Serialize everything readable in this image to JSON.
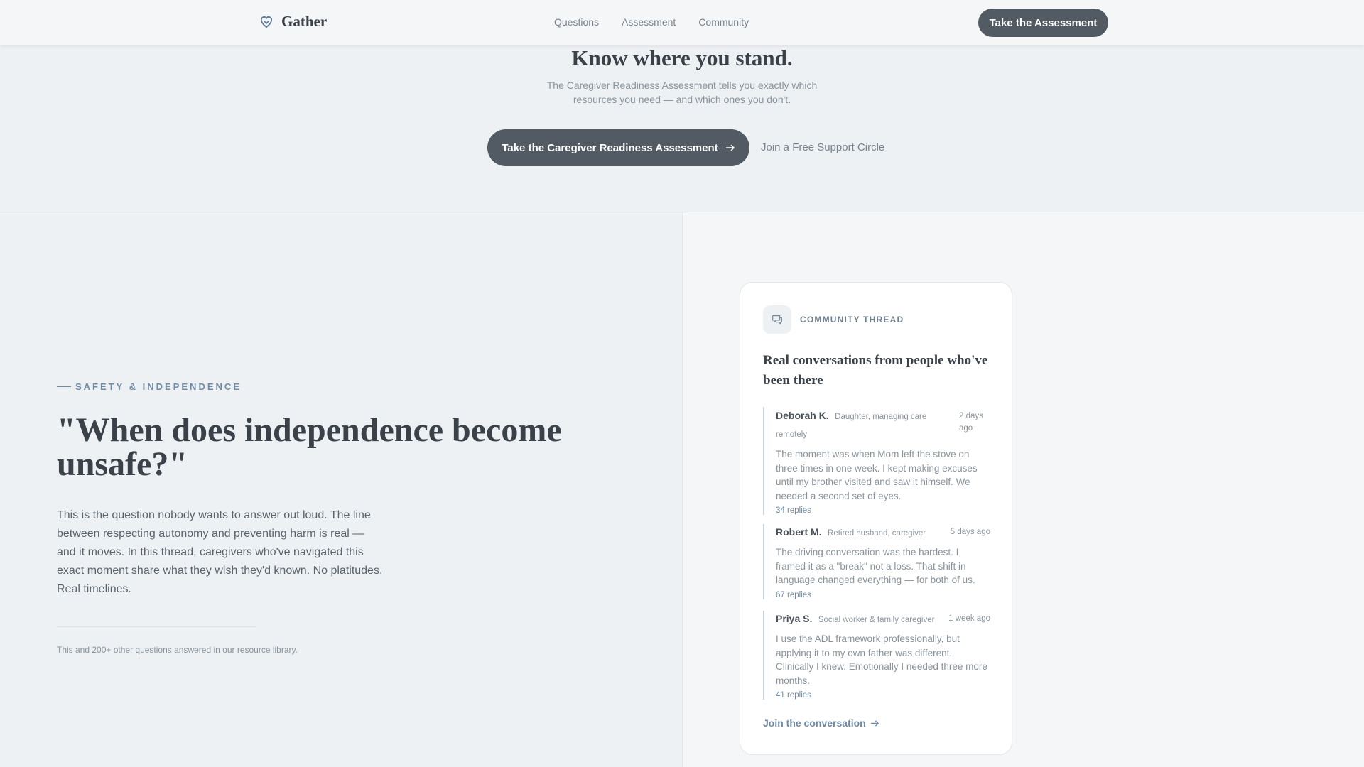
{
  "nav": {
    "brand": "Gather",
    "links": [
      "Questions",
      "Assessment",
      "Community"
    ],
    "cta": "Take the Assessment"
  },
  "hero": {
    "title": "Know where you stand.",
    "subtitle": "The Caregiver Readiness Assessment tells you exactly which resources you need — and which ones you don't.",
    "cta": "Take the Caregiver Readiness Assessment",
    "secondary_link": "Join a Free Support Circle"
  },
  "feature": {
    "eyebrow": "SAFETY & INDEPENDENCE",
    "question": "\"When does independence become unsafe?\"",
    "body": "This is the question nobody wants to answer out loud. The line between respecting autonomy and preventing harm is real — and it moves. In this thread, caregivers who've navigated this exact moment share what they wish they'd known. No platitudes. Real timelines.",
    "footnote": "This and 200+ other questions answered in our resource library."
  },
  "thread": {
    "label": "COMMUNITY THREAD",
    "title": "Real conversations from people who've been there",
    "posts": [
      {
        "author": "Deborah K.",
        "role": "Daughter, managing care remotely",
        "time": "2 days ago",
        "body": "The moment was when Mom left the stove on three times in one week. I kept making excuses until my brother visited and saw it himself. We needed a second set of eyes.",
        "replies": "34 replies"
      },
      {
        "author": "Robert M.",
        "role": "Retired husband, caregiver",
        "time": "5 days ago",
        "body": "The driving conversation was the hardest. I framed it as a \"break\" not a loss. That shift in language changed everything — for both of us.",
        "replies": "67 replies"
      },
      {
        "author": "Priya S.",
        "role": "Social worker & family caregiver",
        "time": "1 week ago",
        "body": "I use the ADL framework professionally, but applying it to my own father was different. Clinically I knew. Emotionally I needed three more months.",
        "replies": "41 replies"
      }
    ],
    "join_link": "Join the conversation"
  },
  "icons": {
    "brand": "heart-shield-icon",
    "card": "chat-bubbles-icon",
    "arrow": "arrow-right-icon"
  }
}
